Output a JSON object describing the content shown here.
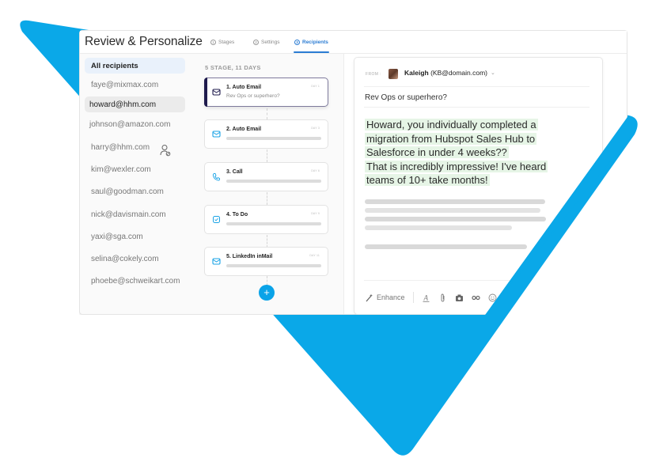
{
  "theme": {
    "accent": "#2b7cd3",
    "brand_blue": "#0aa3e8",
    "stage_active": "#1f1b4d",
    "highlight": "#e6f5e6"
  },
  "header": {
    "title": "Review & Personalize",
    "tabs": [
      {
        "num": "1",
        "label": "Stages",
        "active": false
      },
      {
        "num": "2",
        "label": "Settings",
        "active": false
      },
      {
        "num": "3",
        "label": "Recipients",
        "active": true
      }
    ]
  },
  "recipients": {
    "all_label": "All recipients",
    "items": [
      "faye@mixmax.com",
      "howard@hhm.com",
      "johnson@amazon.com",
      "harry@hhm.com",
      "kim@wexler.com",
      "saul@goodman.com",
      "nick@davismain.com",
      "yaxi@sga.com",
      "selina@cokely.com",
      "phoebe@schweikart.com"
    ],
    "selected": "howard@hhm.com",
    "person_icon": "user-settings-icon"
  },
  "sequence": {
    "summary": "5 STAGE, 11 DAYS",
    "stages": [
      {
        "title": "1. Auto Email",
        "subtitle": "Rev Ops or superhero?",
        "day": "DAY 1",
        "icon": "mail-icon",
        "active": true
      },
      {
        "title": "2. Auto Email",
        "day": "DAY 3",
        "icon": "mail-icon"
      },
      {
        "title": "3. Call",
        "day": "DAY 6",
        "icon": "phone-icon"
      },
      {
        "title": "4. To Do",
        "day": "DAY 9",
        "icon": "checkbox-icon"
      },
      {
        "title": "5. LinkedIn inMail",
        "day": "DAY 11",
        "icon": "mail-icon"
      }
    ],
    "add_label": "+"
  },
  "email": {
    "from_label": "FROM :",
    "from_name": "Kaleigh",
    "from_address": "(KB@domain.com)",
    "subject": "Rev Ops or superhero?",
    "body_lines": [
      "Howard, you individually completed a",
      "migration from Hubspot Sales Hub to",
      "Salesforce in under 4 weeks??",
      "That is incredibly impressive! I've heard",
      "teams of 10+ take months!"
    ],
    "toolbar": {
      "enhance_label": "Enhance"
    }
  }
}
